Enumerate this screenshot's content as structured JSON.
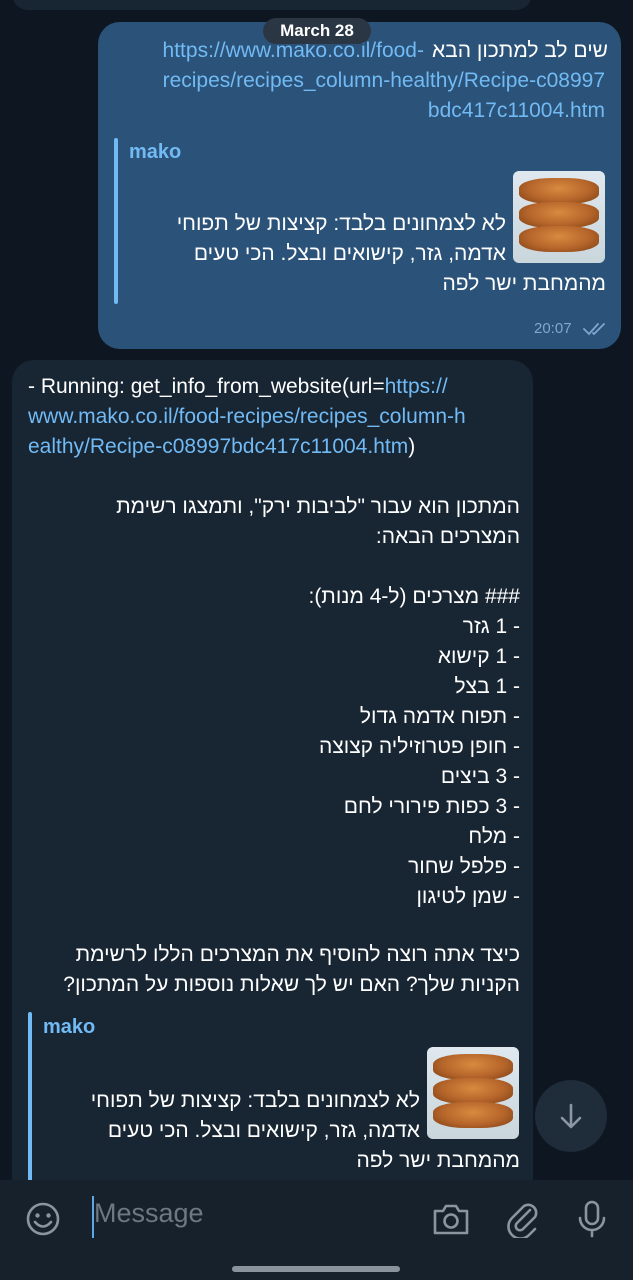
{
  "date_chip": "March 28",
  "outgoing": {
    "text_line1_prefix": "שים לב למתכון הבא",
    "url_line1": "https://www.mako.co.il/food-",
    "url_line2": "recipes/recipes_column-healthy/Recipe-c08997",
    "url_line3": "bdc417c11004.htm",
    "preview": {
      "site": "mako",
      "desc_line1": "לא לצמחונים בלבד: קציצות של תפוחי",
      "desc_line2": "אדמה, גזר, קישואים ובצל. הכי טעים",
      "desc_line3": "מהמחבת ישר לפה"
    },
    "time": "20:07",
    "status_icon": "double-check-icon"
  },
  "incoming": {
    "running_prefix": "- Running: get_info_from_website(url=",
    "running_url1": "https://",
    "running_url2": "www.mako.co.il/food-recipes/recipes_column-h",
    "running_url3": "ealthy/Recipe-c08997bdc417c11004.htm",
    "running_suffix": ")",
    "intro_line1": "המתכון הוא עבור \"לביבות ירק\", ותמצגו רשימת",
    "intro_line2": "המצרכים הבאה:",
    "ingredients_header": "### מצרכים (ל-4 מנות):",
    "ingredients": [
      "- 1 גזר",
      "- 1 קישוא",
      "- 1 בצל",
      "- תפוח אדמה גדול",
      "- חופן פטרוזיליה קצוצה",
      "- 3 ביצים",
      "- 3 כפות פירורי לחם",
      "- מלח",
      "- פלפל שחור",
      "- שמן לטיגון"
    ],
    "question_line1": "כיצד אתה רוצה להוסיף את המצרכים הללו לרשימת",
    "question_line2": "הקניות שלך? האם יש לך שאלות נוספות על המתכון?",
    "preview": {
      "site": "mako",
      "desc_line1": "לא לצמחונים בלבד: קציצות של תפוחי",
      "desc_line2": "אדמה, גזר, קישואים ובצל. הכי טעים",
      "desc_line3": "מהמחבת ישר לפה"
    }
  },
  "input_bar": {
    "placeholder": "Message",
    "icons": [
      "emoji-icon",
      "camera-icon",
      "attach-icon",
      "mic-icon"
    ]
  },
  "scroll_button_icon": "arrow-down-icon",
  "colors": {
    "background": "#0e1621",
    "outgoing_bubble": "#2b5278",
    "incoming_bubble": "#182533",
    "link": "#71baf4"
  }
}
